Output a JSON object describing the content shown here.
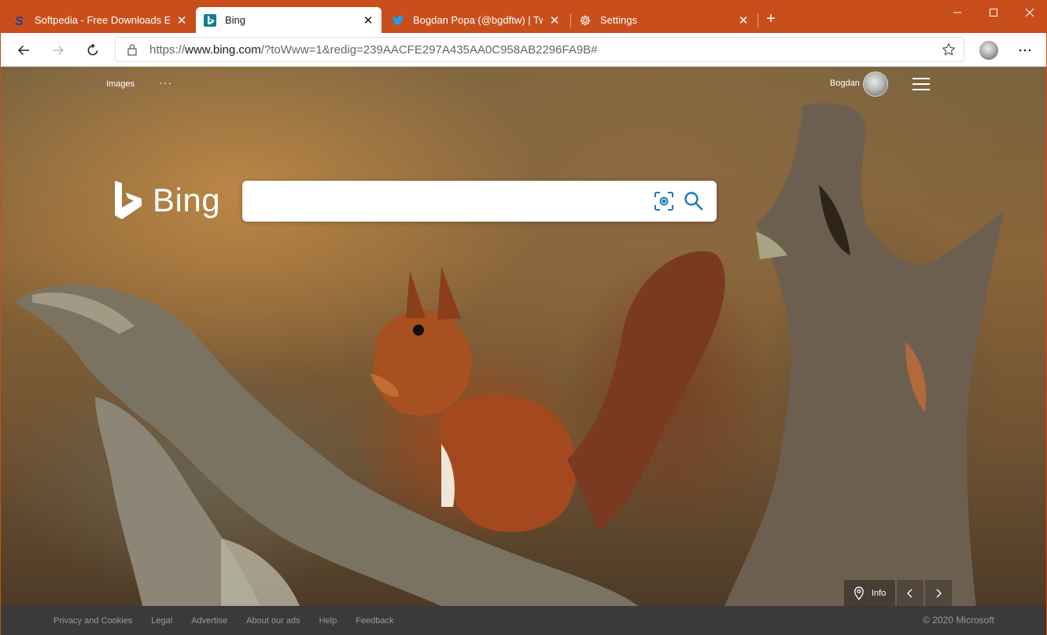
{
  "browser": {
    "tabs": [
      {
        "title": "Softpedia - Free Downloads Ency",
        "icon": "softpedia-icon"
      },
      {
        "title": "Bing",
        "icon": "bing-icon"
      },
      {
        "title": "Bogdan Popa (@bgdftw) | Twitte",
        "icon": "twitter-icon"
      },
      {
        "title": "Settings",
        "icon": "gear-icon"
      }
    ],
    "active_tab": 1,
    "accent_color": "#c84f1b",
    "address": {
      "scheme": "https://",
      "host": "www.bing.com",
      "path": "/?toWww=1&redig=239AACFE297A435AA0C958AB2296FA9B#"
    }
  },
  "bing": {
    "nav": {
      "images_label": "Images",
      "more_label": "···"
    },
    "user": {
      "name": "Bogdan"
    },
    "logo_text": "Bing",
    "search": {
      "value": "",
      "placeholder": ""
    },
    "info_label": "Info",
    "footer": {
      "links": [
        "Privacy and Cookies",
        "Legal",
        "Advertise",
        "About our ads",
        "Help",
        "Feedback"
      ],
      "copyright": "© 2020 Microsoft"
    }
  }
}
